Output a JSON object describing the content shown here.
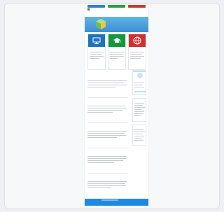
{
  "colors": {
    "topbar_blue": "#2f80d1",
    "topbar_green": "#2e9e3a",
    "topbar_red": "#d0332b",
    "hero_blue": "#3d8fd0",
    "feature_blue": "#1e73be",
    "feature_green": "#119a3b",
    "feature_red": "#d32f2f",
    "footer_blue": "#1e88e5"
  },
  "hero": {
    "title": "",
    "subtitle": ""
  },
  "logo": {
    "text": ""
  },
  "features": [
    {
      "icon": "monitor-icon",
      "title": "",
      "more": ""
    },
    {
      "icon": "graduation-cap-icon",
      "title": "",
      "more": ""
    },
    {
      "icon": "globe-icon",
      "title": "",
      "more": ""
    }
  ],
  "content": {
    "heading": ""
  },
  "articles": [
    {
      "title": "",
      "more": ""
    },
    {
      "title": "",
      "more": ""
    },
    {
      "title": "",
      "more": ""
    },
    {
      "title": "",
      "more": ""
    },
    {
      "title": "",
      "more": ""
    }
  ],
  "sidebar": {
    "box1_label": "",
    "box2_label": "",
    "box3_label": ""
  },
  "footer": {
    "button_label": "",
    "text": ""
  }
}
